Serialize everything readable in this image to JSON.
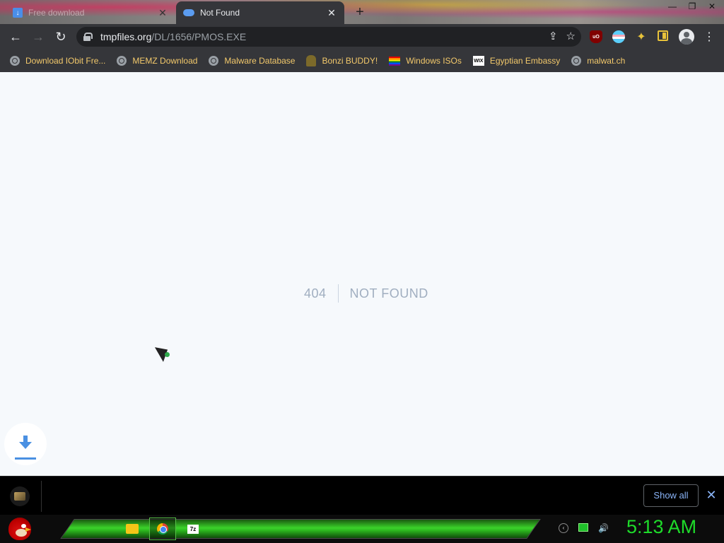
{
  "browser": {
    "tabs": [
      {
        "title": "Free download",
        "active": false
      },
      {
        "title": "Not Found",
        "active": true
      }
    ],
    "new_tab_icon": "plus-icon",
    "window_controls": [
      "minimize-icon",
      "restore-icon",
      "close-icon"
    ],
    "address": {
      "host": "tmpfiles.org",
      "path": "/DL/1656/PMOS.EXE"
    },
    "bookmarks": [
      {
        "label": "Download IObit Fre...",
        "icon": "globe-icon"
      },
      {
        "label": "MEMZ Download",
        "icon": "globe-icon"
      },
      {
        "label": "Malware Database",
        "icon": "globe-icon"
      },
      {
        "label": "Bonzi BUDDY!",
        "icon": "bonzi-icon"
      },
      {
        "label": "Windows ISOs",
        "icon": "rainbow-flag-icon"
      },
      {
        "label": "Egyptian Embassy",
        "icon": "wix-icon"
      },
      {
        "label": "malwat.ch",
        "icon": "globe-icon"
      }
    ],
    "colors": {
      "toolbar": "#35363a",
      "bookmark_text": "#f3c96b",
      "page_bg": "#f6f9fc"
    }
  },
  "page": {
    "error_code": "404",
    "error_message": "NOT FOUND"
  },
  "download_shelf": {
    "show_all_label": "Show all"
  },
  "taskbar": {
    "clock": "5:13 AM",
    "pinned": [
      "folder-icon",
      "chrome-icon",
      "7zip-icon"
    ],
    "accent": "#1edb2a"
  }
}
